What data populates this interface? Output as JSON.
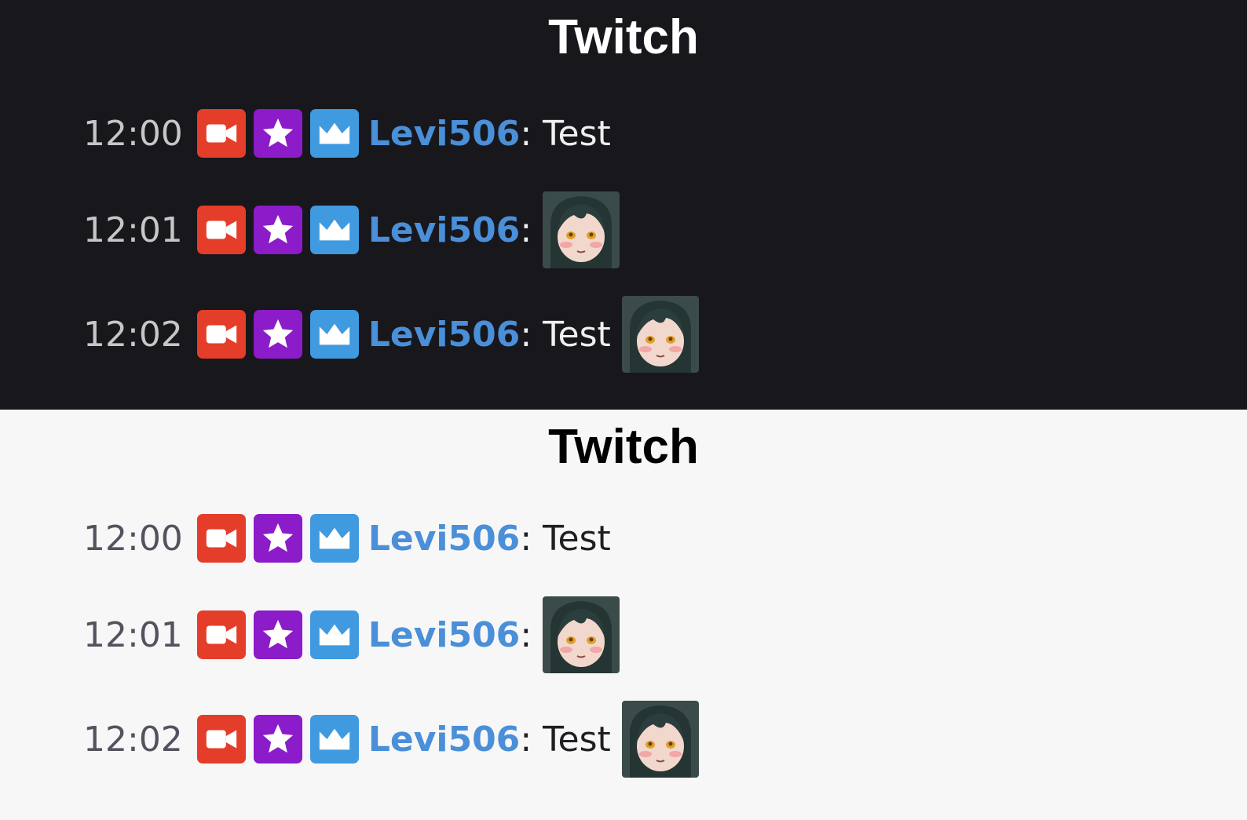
{
  "colors": {
    "dark_bg": "#18171c",
    "light_bg": "#f7f7f7",
    "broadcaster_badge": "#e43d2a",
    "subscriber_badge": "#8c1bc9",
    "vip_badge": "#3f9ae0",
    "username": "#4a8fd8"
  },
  "panels": [
    {
      "theme": "dark",
      "title": "Twitch",
      "messages": [
        {
          "time": "12:00",
          "username": "Levi506",
          "separator": ":",
          "text": "Test",
          "emote": false,
          "badges": [
            "broadcaster-icon",
            "subscriber-star-icon",
            "vip-crown-icon"
          ]
        },
        {
          "time": "12:01",
          "username": "Levi506",
          "separator": ":",
          "text": "",
          "emote": true,
          "badges": [
            "broadcaster-icon",
            "subscriber-star-icon",
            "vip-crown-icon"
          ]
        },
        {
          "time": "12:02",
          "username": "Levi506",
          "separator": ":",
          "text": "Test",
          "emote": true,
          "badges": [
            "broadcaster-icon",
            "subscriber-star-icon",
            "vip-crown-icon"
          ]
        }
      ]
    },
    {
      "theme": "light",
      "title": "Twitch",
      "messages": [
        {
          "time": "12:00",
          "username": "Levi506",
          "separator": ":",
          "text": "Test",
          "emote": false,
          "badges": [
            "broadcaster-icon",
            "subscriber-star-icon",
            "vip-crown-icon"
          ]
        },
        {
          "time": "12:01",
          "username": "Levi506",
          "separator": ":",
          "text": "",
          "emote": true,
          "badges": [
            "broadcaster-icon",
            "subscriber-star-icon",
            "vip-crown-icon"
          ]
        },
        {
          "time": "12:02",
          "username": "Levi506",
          "separator": ":",
          "text": "Test",
          "emote": true,
          "badges": [
            "broadcaster-icon",
            "subscriber-star-icon",
            "vip-crown-icon"
          ]
        }
      ]
    }
  ]
}
